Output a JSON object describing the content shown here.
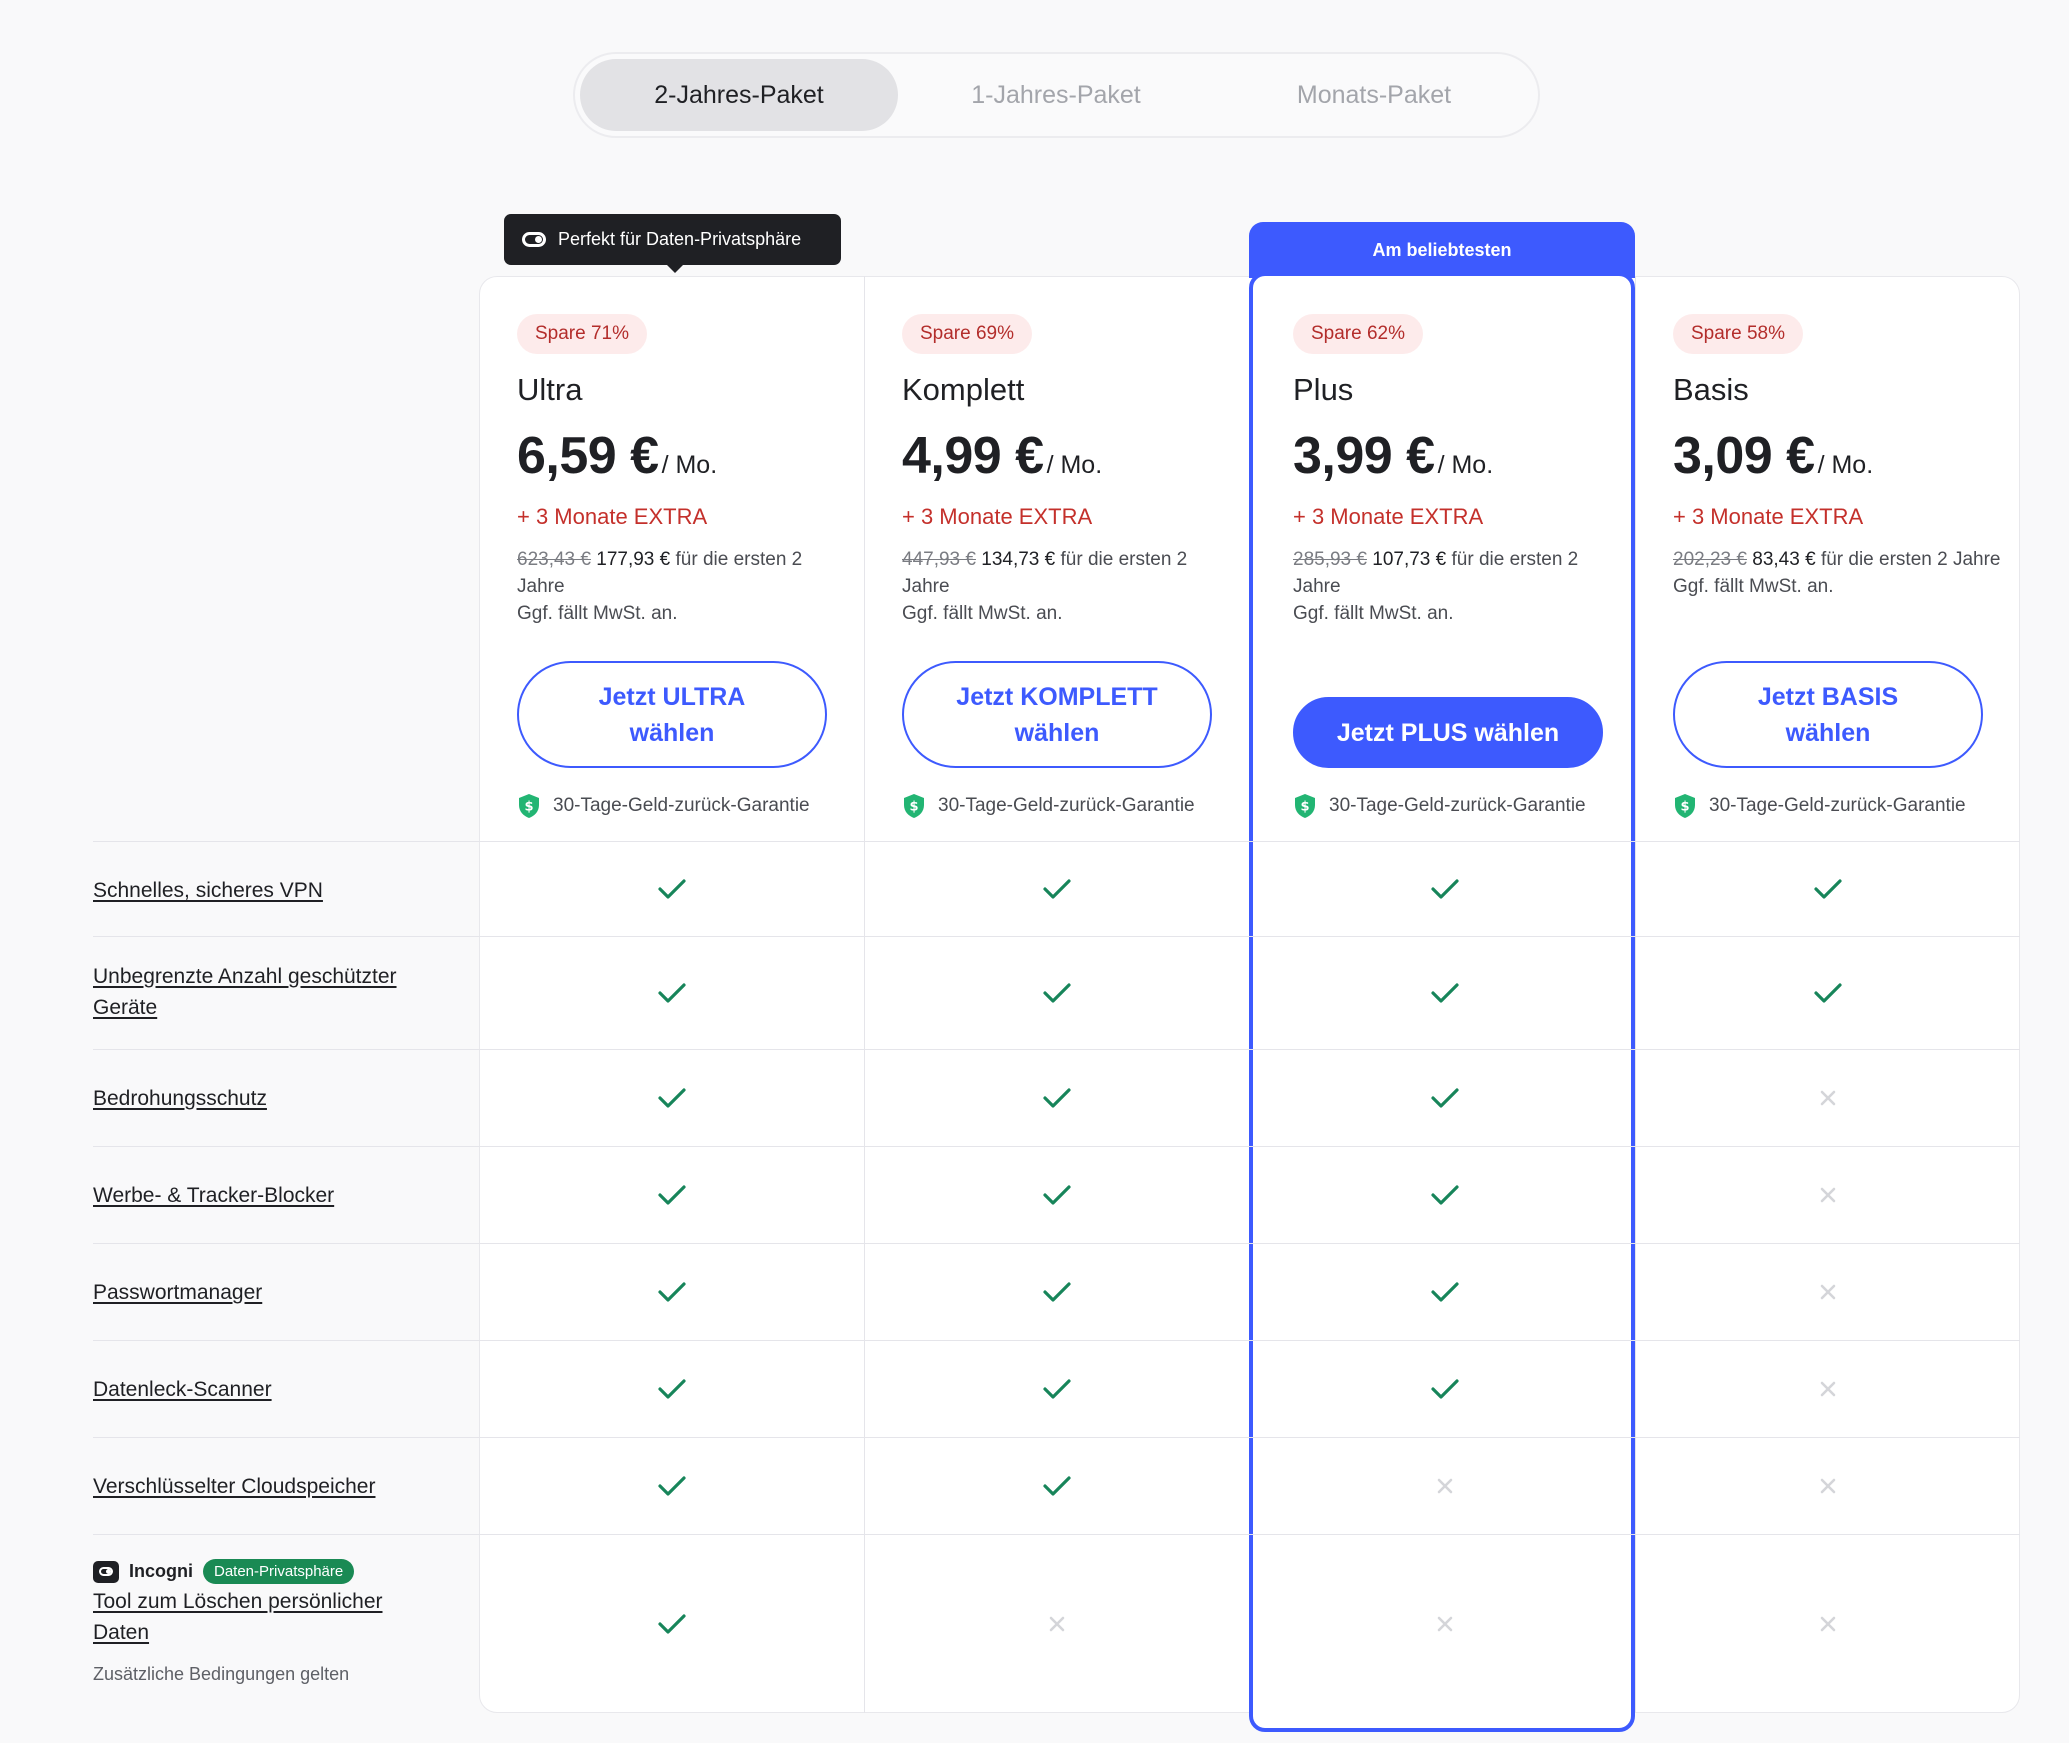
{
  "billing_toggle": {
    "options": [
      "2-Jahres-Paket",
      "1-Jahres-Paket",
      "Monats-Paket"
    ],
    "selected": "2-Jahres-Paket"
  },
  "tooltip": {
    "text": "Perfekt für Daten-Privatsphäre"
  },
  "popular_label": "Am beliebtesten",
  "plans": [
    {
      "badge": "Spare 71%",
      "name": "Ultra",
      "price": "6,59 €",
      "per": "/ Mo.",
      "extra": "+ 3 Monate EXTRA",
      "old_price": "623,43 €",
      "new_price": "177,93 €",
      "period": "für die ersten 2 Jahre",
      "vat": "Ggf. fällt MwSt. an.",
      "button": "Jetzt ULTRA wählen",
      "guarantee": "30-Tage-Geld-zurück-Garantie"
    },
    {
      "badge": "Spare 69%",
      "name": "Komplett",
      "price": "4,99 €",
      "per": "/ Mo.",
      "extra": "+ 3 Monate EXTRA",
      "old_price": "447,93 €",
      "new_price": "134,73 €",
      "period": "für die ersten 2 Jahre",
      "vat": "Ggf. fällt MwSt. an.",
      "button": "Jetzt KOMPLETT wählen",
      "guarantee": "30-Tage-Geld-zurück-Garantie"
    },
    {
      "badge": "Spare 62%",
      "name": "Plus",
      "price": "3,99 €",
      "per": "/ Mo.",
      "extra": "+ 3 Monate EXTRA",
      "old_price": "285,93 €",
      "new_price": "107,73 €",
      "period": "für die ersten 2 Jahre",
      "vat": "Ggf. fällt MwSt. an.",
      "button": "Jetzt PLUS wählen",
      "guarantee": "30-Tage-Geld-zurück-Garantie"
    },
    {
      "badge": "Spare 58%",
      "name": "Basis",
      "price": "3,09 €",
      "per": "/ Mo.",
      "extra": "+ 3 Monate EXTRA",
      "old_price": "202,23 €",
      "new_price": "83,43 €",
      "period": "für die ersten 2 Jahre",
      "vat": "Ggf. fällt MwSt. an.",
      "button": "Jetzt BASIS wählen",
      "guarantee": "30-Tage-Geld-zurück-Garantie"
    }
  ],
  "features": [
    {
      "label": "Schnelles, sicheres VPN",
      "included": [
        true,
        true,
        true,
        true
      ]
    },
    {
      "label": "Unbegrenzte Anzahl geschützter Geräte",
      "included": [
        true,
        true,
        true,
        true
      ]
    },
    {
      "label": "Bedrohungsschutz",
      "included": [
        true,
        true,
        true,
        false
      ]
    },
    {
      "label": "Werbe- & Tracker-Blocker",
      "included": [
        true,
        true,
        true,
        false
      ]
    },
    {
      "label": "Passwortmanager",
      "included": [
        true,
        true,
        true,
        false
      ]
    },
    {
      "label": "Datenleck-Scanner",
      "included": [
        true,
        true,
        true,
        false
      ]
    },
    {
      "label": "Verschlüsselter Cloudspeicher",
      "included": [
        true,
        true,
        false,
        false
      ]
    },
    {
      "label": "Tool zum Löschen persönlicher Daten",
      "included": [
        true,
        false,
        false,
        false
      ]
    }
  ],
  "incogni": {
    "brand": "Incogni",
    "badge": "Daten-Privatsphäre",
    "note": "Zusätzliche Bedingungen gelten"
  },
  "colors": {
    "accent": "#3d5afe",
    "check": "#17855a",
    "cross": "#d4d5d9",
    "badge_text": "#b32d2b",
    "extra_text": "#c4302b"
  },
  "icons": {
    "check": "checkmark-icon",
    "cross": "cross-icon",
    "shield": "shield-dollar-icon",
    "toggle": "toggle-icon"
  }
}
